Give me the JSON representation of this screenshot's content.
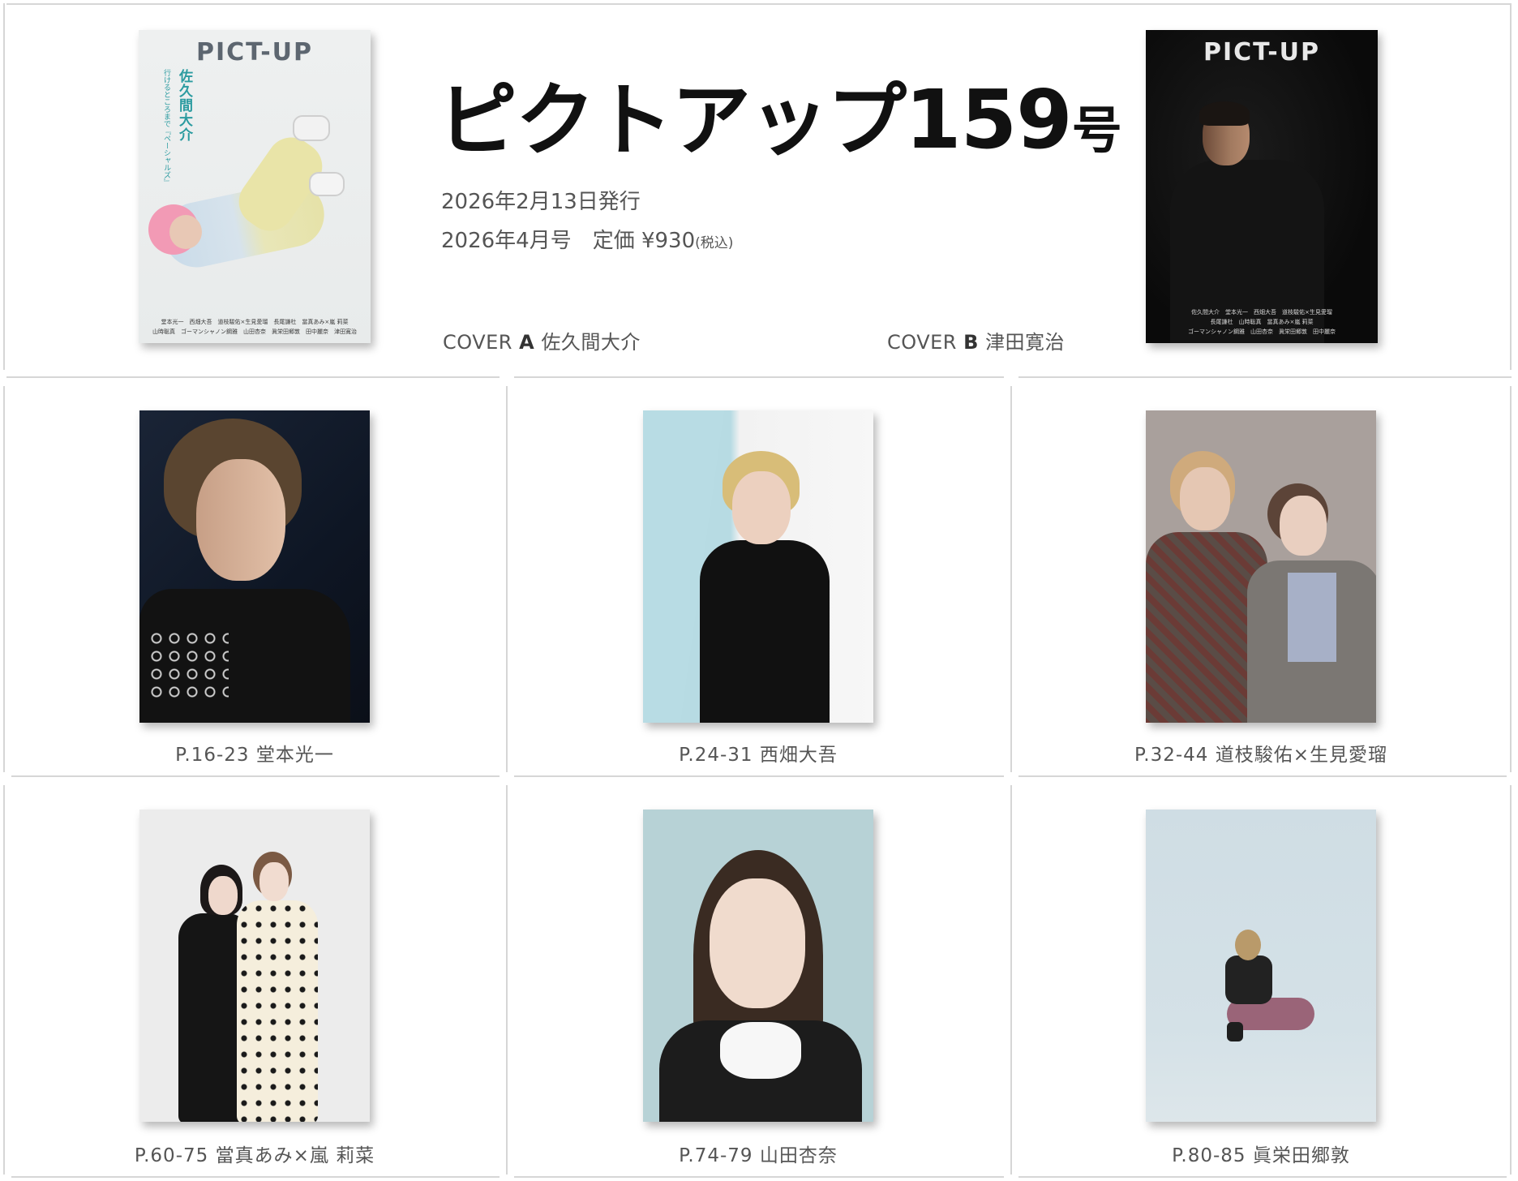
{
  "header": {
    "title_main": "ピクトアップ",
    "title_number": "159",
    "title_suffix": "号",
    "issue_date": "2026年2月13日発行",
    "issue_price_main": "2026年4月号　定価 ¥930",
    "issue_price_tax": "(税込)"
  },
  "covers": {
    "a": {
      "logo": "PICT-UP",
      "label_prefix": "COVER",
      "label_letter": "A",
      "label_name": "佐久間大介",
      "cover_name": "佐久間大介",
      "cover_subtitle": "行けるところまで『ペーシャルズ』",
      "credits_line1": "堂本光一　西畑大吾　道枝駿佑×生見愛瑠　長尾謙杜　當真あみ×嵐 莉菜",
      "credits_line2": "山時聡真　ゴーマンシャノン鋼雅　山田杏奈　眞栄田郷敦　田中麗奈　津田寛治"
    },
    "b": {
      "logo": "PICT-UP",
      "label_prefix": "COVER",
      "label_letter": "B",
      "label_name": "津田寛治",
      "credits_line1": "佐久間大介　堂本光一　西畑大吾　道枝駿佑×生見愛瑠",
      "credits_line2": "長尾謙杜　山時聡真　當真あみ×嵐 莉菜",
      "credits_line3": "ゴーマンシャノン鋼雅　山田杏奈　眞栄田郷敦　田中麗奈"
    }
  },
  "grid": [
    {
      "caption": "P.16-23 堂本光一"
    },
    {
      "caption": "P.24-31 西畑大吾"
    },
    {
      "caption": "P.32-44 道枝駿佑×生見愛瑠"
    },
    {
      "caption": "P.60-75 當真あみ×嵐 莉菜"
    },
    {
      "caption": "P.74-79 山田杏奈"
    },
    {
      "caption": "P.80-85 眞栄田郷敦"
    }
  ],
  "colors": {
    "divider": "#d6d6d6",
    "title": "#111111",
    "text": "#555555",
    "cover_a_accent": "#2b9ba0"
  }
}
